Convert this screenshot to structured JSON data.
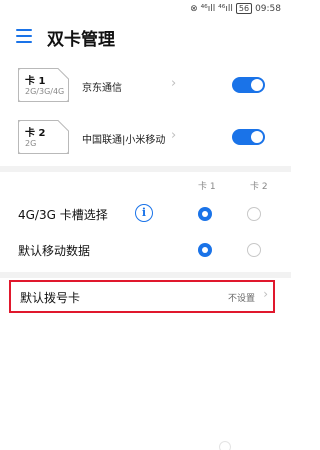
{
  "status_bar": {
    "icons": "⊗ ⁴⁶ıll ⁴⁶ıll",
    "battery": "56",
    "time": "09:58"
  },
  "header": {
    "title": "双卡管理"
  },
  "sims": [
    {
      "name": "卡 1",
      "type": "2G/3G/4G",
      "carrier": "京东通信",
      "enabled": true
    },
    {
      "name": "卡 2",
      "type": "2G",
      "carrier": "中国联通|小米移动",
      "enabled": true
    }
  ],
  "columns": {
    "card1": "卡 1",
    "card2": "卡 2"
  },
  "options": [
    {
      "label": "4G/3G 卡槽选择",
      "has_info": true,
      "selected": "card1"
    },
    {
      "label": "默认移动数据",
      "has_info": false,
      "selected": "card1"
    }
  ],
  "default_dial": {
    "label": "默认拨号卡",
    "value": "不设置"
  },
  "colors": {
    "accent": "#1a73e8",
    "highlight_border": "#e0182d",
    "separator": "#f2f2f2"
  }
}
